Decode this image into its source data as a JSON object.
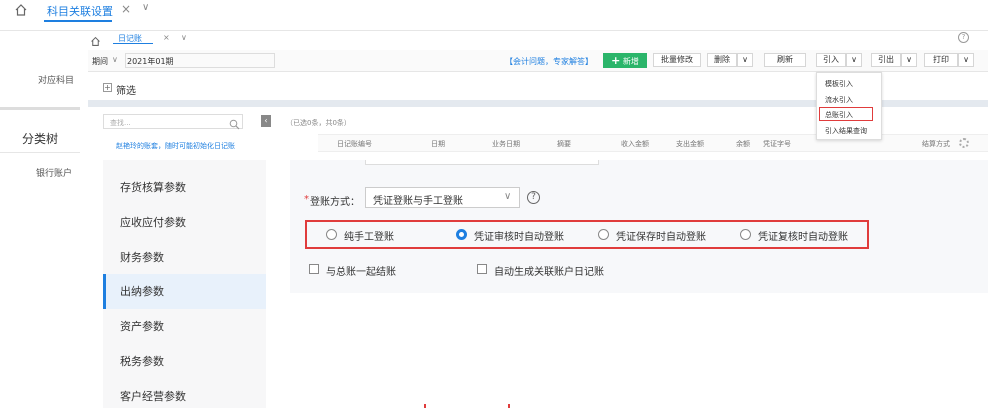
{
  "topnav": {
    "tab1": "科目关联设置",
    "close": "×",
    "dropdown": "∨"
  },
  "innernav": {
    "tab": "日记账",
    "close": "×",
    "dropdown": "∨"
  },
  "toolbar": {
    "period_label": "期间",
    "period_value": "2021年01期",
    "help_link": "【会计问题，专家解答】",
    "add_button": "新增",
    "batch_edit": "批量修改",
    "delete": "删除",
    "refresh": "刷新",
    "import": "引入",
    "export": "引出",
    "print": "打印"
  },
  "left_panel": {
    "related_subject": "对应科目",
    "category_tree": "分类树",
    "bank_account": "银行账户"
  },
  "filter": {
    "label": "筛选"
  },
  "search": {
    "placeholder": "查找..."
  },
  "notice": "赵艳玲的账套，随时可能初始化日记账",
  "selection_summary": "（已选0条，共0条）",
  "table_headers": [
    "日记账编号",
    "日期",
    "业务日期",
    "摘要",
    "收入金额",
    "支出金额",
    "余额",
    "凭证字号",
    "",
    "",
    "结算方式"
  ],
  "import_menu": {
    "items": [
      "模板引入",
      "流水引入",
      "总账引入",
      "引入结果查询"
    ],
    "highlighted": "总账引入"
  },
  "settings_menu": [
    "存货核算参数",
    "应收应付参数",
    "财务参数",
    "出纳参数",
    "资产参数",
    "税务参数",
    "客户经营参数"
  ],
  "active_menu": "出纳参数",
  "form": {
    "required_mark": "*",
    "posting_label": "登账方式：",
    "posting_value": "凭证登账与手工登账",
    "radio_options": [
      "纯手工登账",
      "凭证审核时自动登账",
      "凭证保存时自动登账",
      "凭证复核时自动登账"
    ],
    "radio_selected": "凭证审核时自动登账",
    "checkboxes": [
      "与总账一起结账",
      "自动生成关联账户日记账"
    ]
  },
  "colors": {
    "accent": "#1e7fe0",
    "highlight_border": "#e03c3c",
    "add_button_bg": "#2bb56a"
  },
  "icons": [
    "home-icon",
    "search-icon",
    "help-icon",
    "plus-icon",
    "gear-icon",
    "collapse-icon"
  ]
}
